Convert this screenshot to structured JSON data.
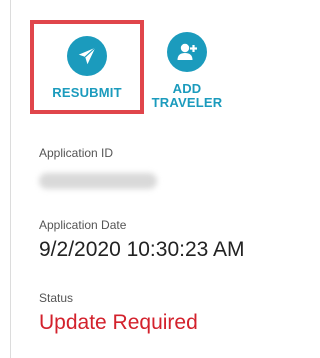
{
  "actions": {
    "resubmit": {
      "label": "RESUBMIT",
      "icon": "paper-plane-icon"
    },
    "add_traveler": {
      "label": "ADD\nTRAVELER",
      "icon": "add-user-icon"
    }
  },
  "application": {
    "id_label": "Application ID",
    "date_label": "Application Date",
    "date_value": "9/2/2020 10:30:23 AM",
    "status_label": "Status",
    "status_value": "Update Required"
  },
  "colors": {
    "accent": "#1b9bbd",
    "highlight_border": "#e0454b",
    "status": "#d3212c"
  }
}
